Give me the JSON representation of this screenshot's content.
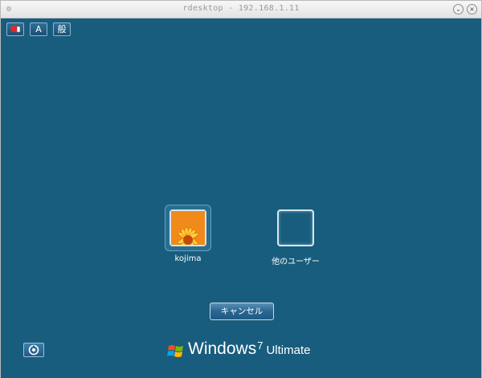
{
  "window": {
    "title": "rdesktop - 192.168.1.11"
  },
  "toolbar": {
    "buttons": [
      {
        "label": "",
        "icon": "ime-pad-icon"
      },
      {
        "label": "A",
        "icon": "input-mode-icon"
      },
      {
        "label": "般",
        "icon": "conversion-mode-icon"
      }
    ]
  },
  "users": [
    {
      "name": "kojima",
      "selected": true,
      "picture": "orange-flower"
    },
    {
      "name": "他のユーザー",
      "selected": false,
      "picture": "blank"
    }
  ],
  "cancel_button": {
    "label": "キャンセル"
  },
  "ease_of_access": {
    "icon": "ease-of-access-icon"
  },
  "branding": {
    "windows": "Windows",
    "version": "7",
    "edition": "Ultimate"
  }
}
